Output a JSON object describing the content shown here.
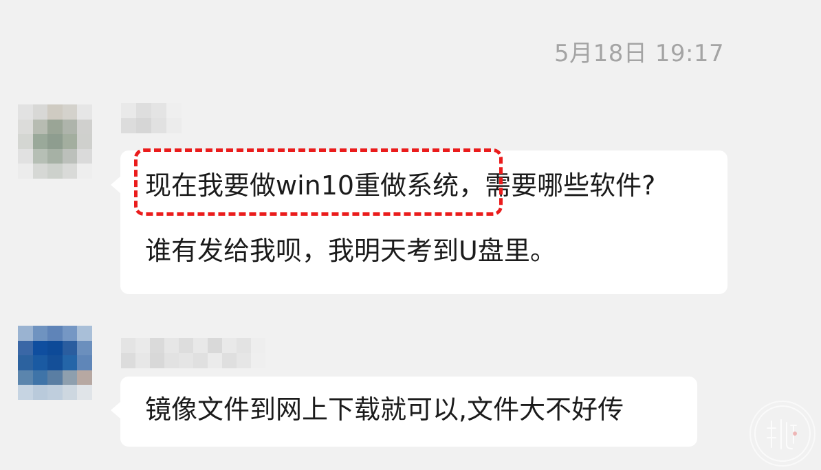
{
  "chat": {
    "timestamp": "5月18日 19:17",
    "messages": [
      {
        "lines": [
          "现在我要做win10重做系统，需要哪些软件?",
          "谁有发给我呗，我明天考到U盘里。"
        ]
      },
      {
        "lines": [
          "镜像文件到网上下载就可以,文件大不好传"
        ]
      }
    ]
  },
  "colors": {
    "background": "#f1f1f1",
    "bubble": "#ffffff",
    "highlight_border": "#ea1c1c",
    "timestamp_text": "#a4a4a4"
  },
  "icons": {
    "watermark": "watermark-seal-icon"
  }
}
